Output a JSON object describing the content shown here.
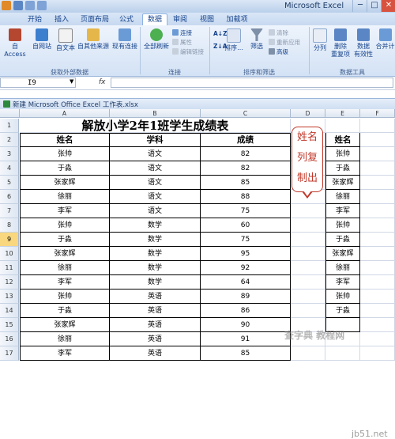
{
  "window": {
    "title": "Microsoft Excel",
    "minimize": "─",
    "maximize": "□",
    "close": "✕"
  },
  "tabs": [
    {
      "label": "开始",
      "active": false
    },
    {
      "label": "插入",
      "active": false
    },
    {
      "label": "页面布局",
      "active": false
    },
    {
      "label": "公式",
      "active": false
    },
    {
      "label": "数据",
      "active": true
    },
    {
      "label": "审阅",
      "active": false
    },
    {
      "label": "视图",
      "active": false
    },
    {
      "label": "加载项",
      "active": false
    }
  ],
  "ribbon": {
    "external": {
      "group_label": "获取外部数据",
      "access": "自 Access",
      "web": "自网站",
      "text": "自文本",
      "other": "自其他来源",
      "existing": "现有连接"
    },
    "connections": {
      "group_label": "连接",
      "refresh_all": "全部刷新",
      "connections": "连接",
      "properties": "属性",
      "edit_links": "编辑链接"
    },
    "sort_filter": {
      "group_label": "排序和筛选",
      "az": "A↓Z",
      "za": "Z↓A",
      "sort": "排序...",
      "filter": "筛选",
      "clear": "清除",
      "reapply": "重新应用",
      "advanced": "高级"
    },
    "data_tools": {
      "group_label": "数据工具",
      "text_to_columns": "分列",
      "remove_dup_1": "删除",
      "remove_dup_2": "重复项",
      "validation_1": "数据",
      "validation_2": "有效性",
      "consolidate": "合并计"
    },
    "colors": {
      "accent": "#15428b",
      "ribbon_bg": "#dbe7f6"
    }
  },
  "formula_bar": {
    "name_box": "I9",
    "fx": "fx",
    "value": ""
  },
  "workbook": {
    "title": "新建 Microsoft Office Excel 工作表.xlsx"
  },
  "sheet": {
    "columns": [
      "A",
      "B",
      "C",
      "D",
      "E",
      "F"
    ],
    "selected_row": "9",
    "title": "解放小学2年1班学生成绩表",
    "headers": {
      "name": "姓名",
      "subject": "学科",
      "score": "成绩",
      "copy_name": "姓名"
    },
    "rows": [
      {
        "n": "1"
      },
      {
        "n": "2"
      },
      {
        "n": "3",
        "name": "张帅",
        "subject": "语文",
        "score": "82",
        "copy": "张帅"
      },
      {
        "n": "4",
        "name": "于淼",
        "subject": "语文",
        "score": "82",
        "copy": "于淼"
      },
      {
        "n": "5",
        "name": "张家辉",
        "subject": "语文",
        "score": "85",
        "copy": "张家辉"
      },
      {
        "n": "6",
        "name": "徐丽",
        "subject": "语文",
        "score": "88",
        "copy": "徐丽"
      },
      {
        "n": "7",
        "name": "李军",
        "subject": "语文",
        "score": "75",
        "copy": "李军"
      },
      {
        "n": "8",
        "name": "张帅",
        "subject": "数学",
        "score": "60",
        "copy": "张帅"
      },
      {
        "n": "9",
        "name": "于淼",
        "subject": "数学",
        "score": "75",
        "copy": "于淼"
      },
      {
        "n": "10",
        "name": "张家辉",
        "subject": "数学",
        "score": "95",
        "copy": "张家辉"
      },
      {
        "n": "11",
        "name": "徐丽",
        "subject": "数学",
        "score": "92",
        "copy": "徐丽"
      },
      {
        "n": "12",
        "name": "李军",
        "subject": "数学",
        "score": "64",
        "copy": "李军"
      },
      {
        "n": "13",
        "name": "张帅",
        "subject": "英语",
        "score": "89",
        "copy": "张帅"
      },
      {
        "n": "14",
        "name": "于淼",
        "subject": "英语",
        "score": "86",
        "copy": "于淼"
      },
      {
        "n": "15",
        "name": "张家辉",
        "subject": "英语",
        "score": "90",
        "copy": ""
      },
      {
        "n": "16",
        "name": "徐丽",
        "subject": "英语",
        "score": "91",
        "copy": ""
      },
      {
        "n": "17",
        "name": "李军",
        "subject": "英语",
        "score": "85",
        "copy": ""
      }
    ],
    "callout": [
      "姓名",
      "列复",
      "制出"
    ]
  },
  "watermark": {
    "site": "jb51.net",
    "text": "查字典 教程网"
  }
}
